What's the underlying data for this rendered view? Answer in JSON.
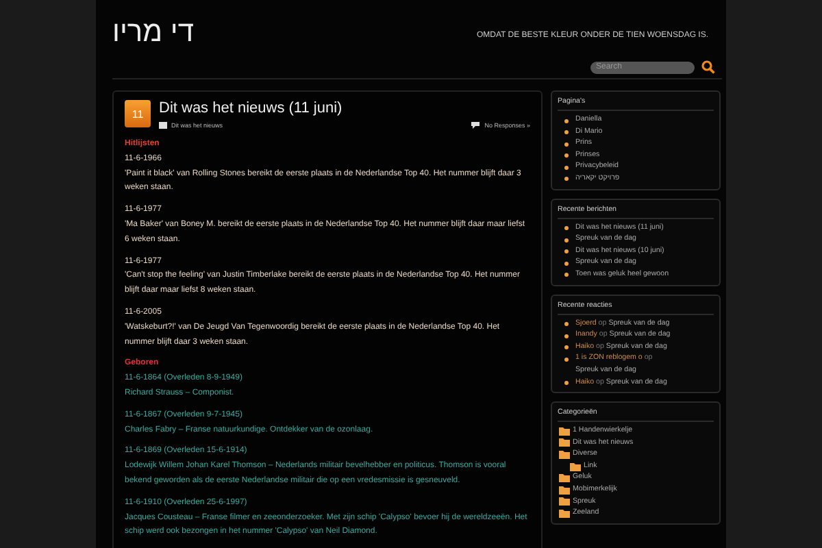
{
  "site": {
    "title": "די מריו",
    "tagline": "OMDAT DE BESTE KLEUR ONDER DE TIEN WOENSDAG IS.",
    "search": {
      "placeholder": "Search"
    }
  },
  "post": {
    "day": "11",
    "title": "Dit was het nieuws (11 juni)",
    "category": "Dit was het nieuws",
    "responses": "No Responses »",
    "sections": [
      {
        "heading": "Hitlijsten",
        "kind": "hits",
        "entries": [
          {
            "date": "11-6-1966",
            "text": "'Paint it black' van Rolling Stones bereikt de eerste plaats in de Nederlandse Top 40. Het nummer blijft daar 3 weken staan."
          },
          {
            "date": "11-6-1977",
            "text": "'Ma Baker' van Boney M. bereikt de eerste plaats in de Nederlandse Top 40. Het nummer blijft daar maar liefst 6 weken staan."
          },
          {
            "date": "11-6-1977",
            "text": "'Can't stop the feeling' van Justin Timberlake bereikt de eerste plaats in de Nederlandse Top 40. Het nummer blijft daar maar liefst 8 weken staan."
          },
          {
            "date": "11-6-2005",
            "text": "'Watskeburt?!' van De Jeugd Van Tegenwoordig bereikt de eerste plaats in de Nederlandse Top 40. Het nummer blijft daar 3 weken staan."
          }
        ]
      },
      {
        "heading": "Geboren",
        "kind": "births",
        "entries": [
          {
            "date": "11-6-1864 (Overleden 8-9-1949)",
            "text": "Richard Strauss – Componist."
          },
          {
            "date": "11-6-1867 (Overleden 9-7-1945)",
            "text": "Charles Fabry – Franse natuurkundige. Ontdekker van de ozonlaag."
          },
          {
            "date": "11-6-1869 (Overleden 15-6-1914)",
            "text": "Lodewijk Willem Johan Karel Thomson – Nederlands militair bevelhebber en politicus. Thomson is vooral bekend geworden als de eerste Nederlandse militair die op een vredesmissie is gesneuveld."
          },
          {
            "date": "11-6-1910 (Overleden 25-6-1997)",
            "text": "Jacques Cousteau – Franse filmer en zeeonderzoeker. Met zijn schip 'Calypso' bevoer hij de wereldzeeën. Het schip werd ook bezongen in het nummer 'Calypso' van Neil Diamond."
          }
        ]
      }
    ]
  },
  "sidebar": {
    "pages": {
      "title": "Pagina's",
      "items": [
        "Daniella",
        "Di Mario",
        "Prins",
        "Prinses",
        "Privacybeleid",
        "פרויקט יקאריה"
      ]
    },
    "recent_posts": {
      "title": "Recente berichten",
      "items": [
        "Dit was het nieuws (11 juni)",
        "Spreuk van de dag",
        "Dit was het nieuws (10 juni)",
        "Spreuk van de dag",
        "Toen was geluk heel gewoon"
      ]
    },
    "recent_comments": {
      "title": "Recente reacties",
      "items": [
        {
          "author": "Sjoerd",
          "connector": "op",
          "post": "Spreuk van de dag"
        },
        {
          "author": "Inandy",
          "connector": "op",
          "post": "Spreuk van de dag"
        },
        {
          "author": "Haiko",
          "connector": "op",
          "post": "Spreuk van de dag"
        },
        {
          "author": "1 is ZON reblogem o",
          "connector": "op",
          "post": "Spreuk van de dag"
        },
        {
          "author": "Haiko",
          "connector": "op",
          "post": "Spreuk van de dag"
        }
      ]
    },
    "categories": {
      "title": "Categorieën",
      "items": [
        {
          "label": "1 Handenwierkelje"
        },
        {
          "label": "Dit was het nieuws"
        },
        {
          "label": "Diverse",
          "children": [
            {
              "label": "Link"
            }
          ]
        },
        {
          "label": "Geluk"
        },
        {
          "label": "Mobimerkelijk"
        },
        {
          "label": "Spreuk"
        },
        {
          "label": "Zeeland"
        }
      ]
    }
  }
}
